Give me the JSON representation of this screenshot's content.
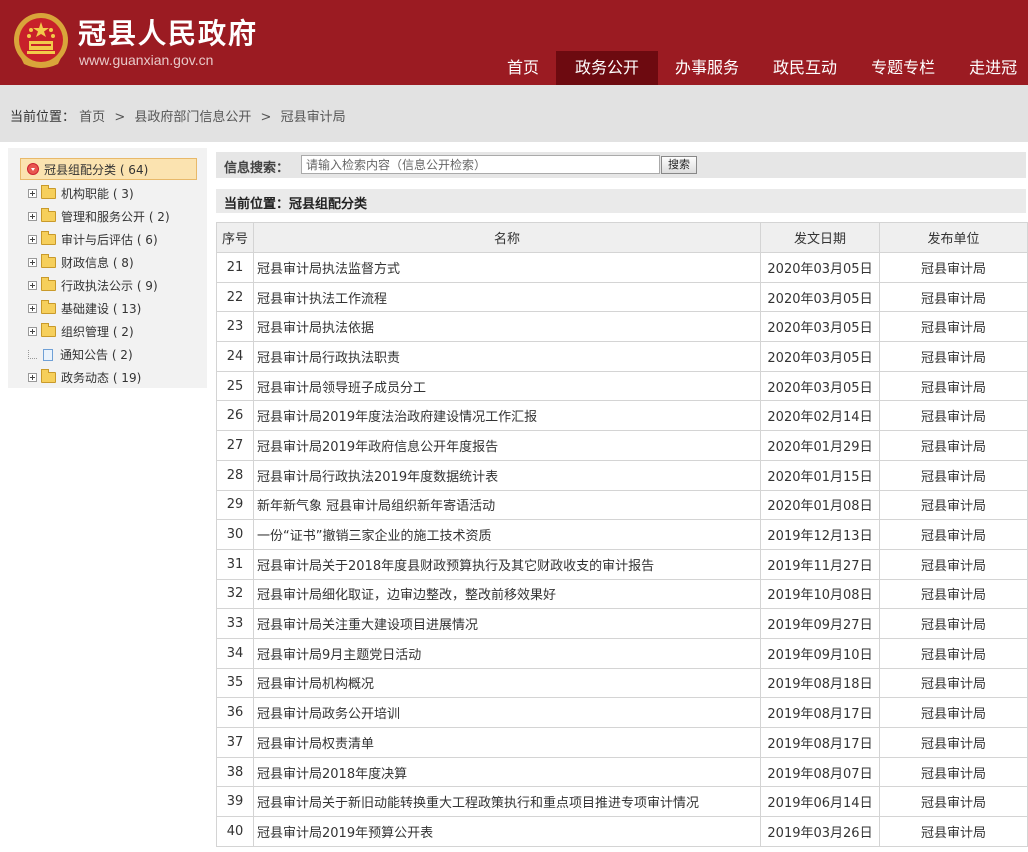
{
  "header": {
    "site_title": "冠县人民政府",
    "site_url": "www.guanxian.gov.cn",
    "nav": [
      {
        "label": "首页",
        "active": false
      },
      {
        "label": "政务公开",
        "active": true
      },
      {
        "label": "办事服务",
        "active": false
      },
      {
        "label": "政民互动",
        "active": false
      },
      {
        "label": "专题专栏",
        "active": false
      },
      {
        "label": "走进冠",
        "active": false
      }
    ]
  },
  "breadcrumb": {
    "label": "当前位置：",
    "items": [
      "首页",
      "县政府部门信息公开",
      "冠县审计局"
    ],
    "separator": ">"
  },
  "tree": {
    "root": "冠县组配分类 ( 64)",
    "items": [
      {
        "label": "机构职能 ( 3)",
        "type": "folder"
      },
      {
        "label": "管理和服务公开 ( 2)",
        "type": "folder"
      },
      {
        "label": "审计与后评估 ( 6)",
        "type": "folder"
      },
      {
        "label": "财政信息 ( 8)",
        "type": "folder"
      },
      {
        "label": "行政执法公示 ( 9)",
        "type": "folder"
      },
      {
        "label": "基础建设 ( 13)",
        "type": "folder"
      },
      {
        "label": "组织管理 ( 2)",
        "type": "folder"
      },
      {
        "label": "通知公告 ( 2)",
        "type": "doc"
      },
      {
        "label": "政务动态 ( 19)",
        "type": "folder"
      }
    ]
  },
  "search": {
    "label": "信息搜索：",
    "placeholder": "请输入检索内容（信息公开检索）",
    "value": "",
    "button": "搜索"
  },
  "position_title": "当前位置：冠县组配分类",
  "table": {
    "headers": [
      "序号",
      "名称",
      "发文日期",
      "发布单位"
    ],
    "rows": [
      {
        "num": "21",
        "name": "冠县审计局执法监督方式",
        "date": "2020年03月05日",
        "unit": "冠县审计局"
      },
      {
        "num": "22",
        "name": "冠县审计执法工作流程",
        "date": "2020年03月05日",
        "unit": "冠县审计局"
      },
      {
        "num": "23",
        "name": "冠县审计局执法依据",
        "date": "2020年03月05日",
        "unit": "冠县审计局"
      },
      {
        "num": "24",
        "name": "冠县审计局行政执法职责",
        "date": "2020年03月05日",
        "unit": "冠县审计局"
      },
      {
        "num": "25",
        "name": "冠县审计局领导班子成员分工",
        "date": "2020年03月05日",
        "unit": "冠县审计局"
      },
      {
        "num": "26",
        "name": "冠县审计局2019年度法治政府建设情况工作汇报",
        "date": "2020年02月14日",
        "unit": "冠县审计局"
      },
      {
        "num": "27",
        "name": "冠县审计局2019年政府信息公开年度报告",
        "date": "2020年01月29日",
        "unit": "冠县审计局"
      },
      {
        "num": "28",
        "name": "冠县审计局行政执法2019年度数据统计表",
        "date": "2020年01月15日",
        "unit": "冠县审计局"
      },
      {
        "num": "29",
        "name": "新年新气象 冠县审计局组织新年寄语活动",
        "date": "2020年01月08日",
        "unit": "冠县审计局"
      },
      {
        "num": "30",
        "name": "一份“证书”撤销三家企业的施工技术资质",
        "date": "2019年12月13日",
        "unit": "冠县审计局"
      },
      {
        "num": "31",
        "name": "冠县审计局关于2018年度县财政预算执行及其它财政收支的审计报告",
        "date": "2019年11月27日",
        "unit": "冠县审计局"
      },
      {
        "num": "32",
        "name": "冠县审计局细化取证，边审边整改，整改前移效果好",
        "date": "2019年10月08日",
        "unit": "冠县审计局"
      },
      {
        "num": "33",
        "name": "冠县审计局关注重大建设项目进展情况",
        "date": "2019年09月27日",
        "unit": "冠县审计局"
      },
      {
        "num": "34",
        "name": "冠县审计局9月主题党日活动",
        "date": "2019年09月10日",
        "unit": "冠县审计局"
      },
      {
        "num": "35",
        "name": "冠县审计局机构概况",
        "date": "2019年08月18日",
        "unit": "冠县审计局"
      },
      {
        "num": "36",
        "name": "冠县审计局政务公开培训",
        "date": "2019年08月17日",
        "unit": "冠县审计局"
      },
      {
        "num": "37",
        "name": "冠县审计局权责清单",
        "date": "2019年08月17日",
        "unit": "冠县审计局"
      },
      {
        "num": "38",
        "name": "冠县审计局2018年度决算",
        "date": "2019年08月07日",
        "unit": "冠县审计局"
      },
      {
        "num": "39",
        "name": "冠县审计局关于新旧动能转换重大工程政策执行和重点项目推进专项审计情况",
        "date": "2019年06月14日",
        "unit": "冠县审计局"
      },
      {
        "num": "40",
        "name": "冠县审计局2019年预算公开表",
        "date": "2019年03月26日",
        "unit": "冠县审计局"
      }
    ]
  },
  "colors": {
    "header_bg": "#9b1b22",
    "nav_active_bg": "#6d0a10",
    "breadcrumb_bg": "#e2e2e2",
    "tree_root_bg": "#fbe3b0"
  }
}
